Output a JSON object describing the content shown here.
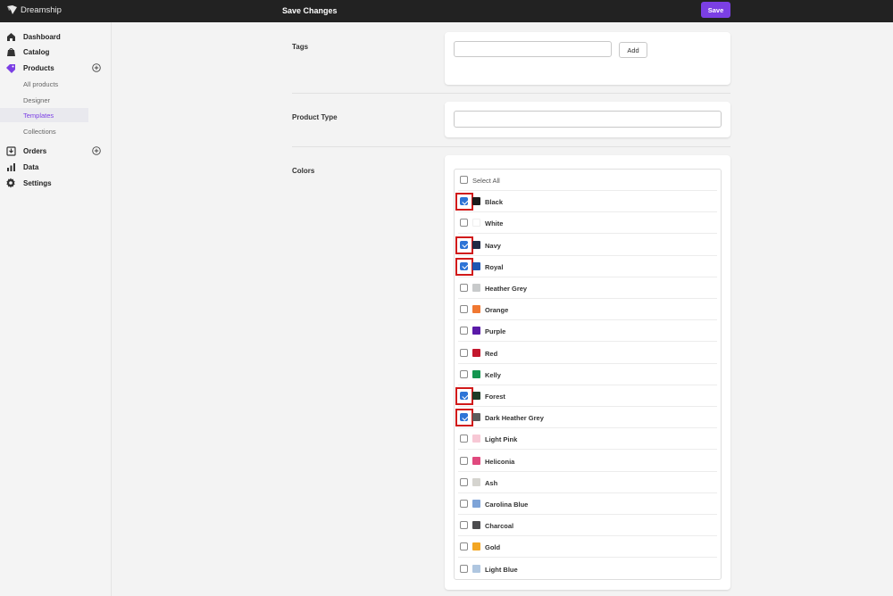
{
  "app": {
    "name": "Dreamship"
  },
  "header": {
    "title": "Save Changes",
    "save_label": "Save"
  },
  "sidebar": {
    "items": [
      {
        "label": "Dashboard",
        "icon": "home-icon"
      },
      {
        "label": "Catalog",
        "icon": "catalog-icon"
      },
      {
        "label": "Products",
        "icon": "tag-icon"
      },
      {
        "label": "Orders",
        "icon": "download-icon"
      },
      {
        "label": "Data",
        "icon": "bar-chart-icon"
      },
      {
        "label": "Settings",
        "icon": "gear-icon"
      }
    ],
    "sub_items": [
      {
        "label": "All products"
      },
      {
        "label": "Designer"
      },
      {
        "label": "Templates",
        "active": true
      },
      {
        "label": "Collections"
      }
    ]
  },
  "form": {
    "tags": {
      "label": "Tags",
      "value": "",
      "add_label": "Add"
    },
    "product_type": {
      "label": "Product Type",
      "value": ""
    },
    "colors": {
      "label": "Colors",
      "select_all_label": "Select All",
      "options": [
        {
          "name": "Black",
          "hex": "#1c1c1c",
          "checked": true
        },
        {
          "name": "White",
          "hex": "#ffffff",
          "checked": false
        },
        {
          "name": "Navy",
          "hex": "#1f2a44",
          "checked": true
        },
        {
          "name": "Royal",
          "hex": "#1f56b3",
          "checked": true
        },
        {
          "name": "Heather Grey",
          "hex": "#c8cacb",
          "checked": false
        },
        {
          "name": "Orange",
          "hex": "#f07832",
          "checked": false
        },
        {
          "name": "Purple",
          "hex": "#5a1aa8",
          "checked": false
        },
        {
          "name": "Red",
          "hex": "#c3172d",
          "checked": false
        },
        {
          "name": "Kelly",
          "hex": "#149650",
          "checked": false
        },
        {
          "name": "Forest",
          "hex": "#1d3b27",
          "checked": true
        },
        {
          "name": "Dark Heather Grey",
          "hex": "#5c5c5c",
          "checked": true
        },
        {
          "name": "Light Pink",
          "hex": "#f7c8d5",
          "checked": false
        },
        {
          "name": "Heliconia",
          "hex": "#e0497e",
          "checked": false
        },
        {
          "name": "Ash",
          "hex": "#d5d4cf",
          "checked": false
        },
        {
          "name": "Carolina Blue",
          "hex": "#7ea4d8",
          "checked": false
        },
        {
          "name": "Charcoal",
          "hex": "#4d4d4f",
          "checked": false
        },
        {
          "name": "Gold",
          "hex": "#f3a623",
          "checked": false
        },
        {
          "name": "Light Blue",
          "hex": "#afc6e0",
          "checked": false
        }
      ]
    }
  },
  "accent_color": "#7b3fe4",
  "highlight_color": "#d11a1a"
}
